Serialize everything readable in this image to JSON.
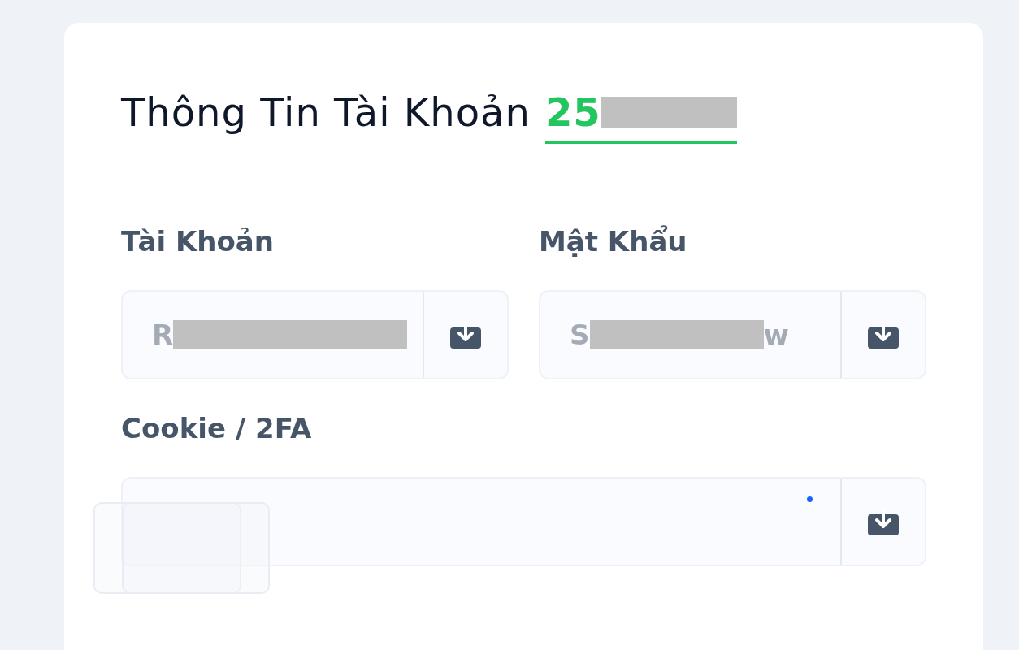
{
  "heading": {
    "text": "Thông Tin Tài Khoản",
    "account_start": "25",
    "redacted": true
  },
  "fields": [
    {
      "label": "Tài Khoản",
      "value_start": "R",
      "redacted": true
    },
    {
      "label": "Mật Khẩu",
      "value_start": "S",
      "redacted": true,
      "value_end": "w"
    },
    {
      "label": "Cookie / 2FA",
      "wide": true,
      "focused": true
    }
  ]
}
